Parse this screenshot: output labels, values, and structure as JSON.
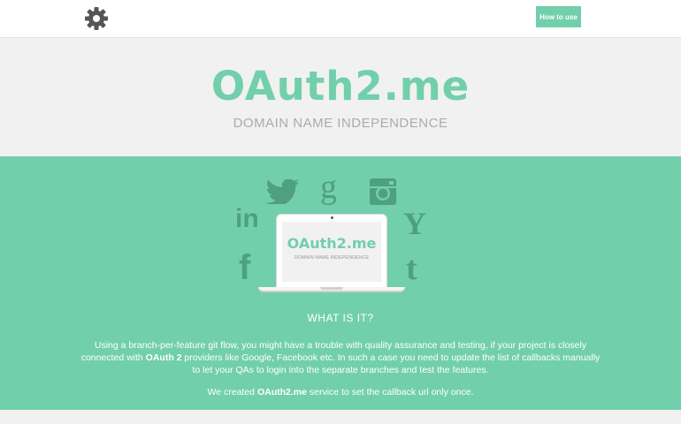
{
  "header": {
    "logo_icon": "gear-icon",
    "how_to_use_label": "How to use",
    "accent_color": "#72cfac"
  },
  "hero": {
    "title": "OAuth2.me",
    "subtitle": "DOMAIN NAME INDEPENDENCE"
  },
  "providers": {
    "icons": [
      "linkedin-icon",
      "twitter-icon",
      "google-icon",
      "instagram-icon",
      "yahoo-icon",
      "facebook-icon",
      "tumblr-icon"
    ],
    "linkedin_glyph": "in",
    "google_glyph": "g",
    "yahoo_glyph": "Y",
    "facebook_glyph": "f",
    "tumblr_glyph": "t"
  },
  "laptop": {
    "title": "OAuth2.me",
    "subtitle": "DOMAIN NAME INDEPENDENCE"
  },
  "about": {
    "heading": "WHAT IS IT?",
    "desc_part1": "Using a branch-per-feature git flow, you might have a trouble with quality assurance and testing, if your project is closely connected with ",
    "desc_bold": "OAuth 2",
    "desc_part2": " providers like Google, Facebook etc. In such a case you need to update the list of callbacks manually to let your QAs to login into the separate branches and test the features.",
    "note_part1": "We created ",
    "note_bold": "OAuth2.me",
    "note_part2": " service to set the callback url only once."
  }
}
